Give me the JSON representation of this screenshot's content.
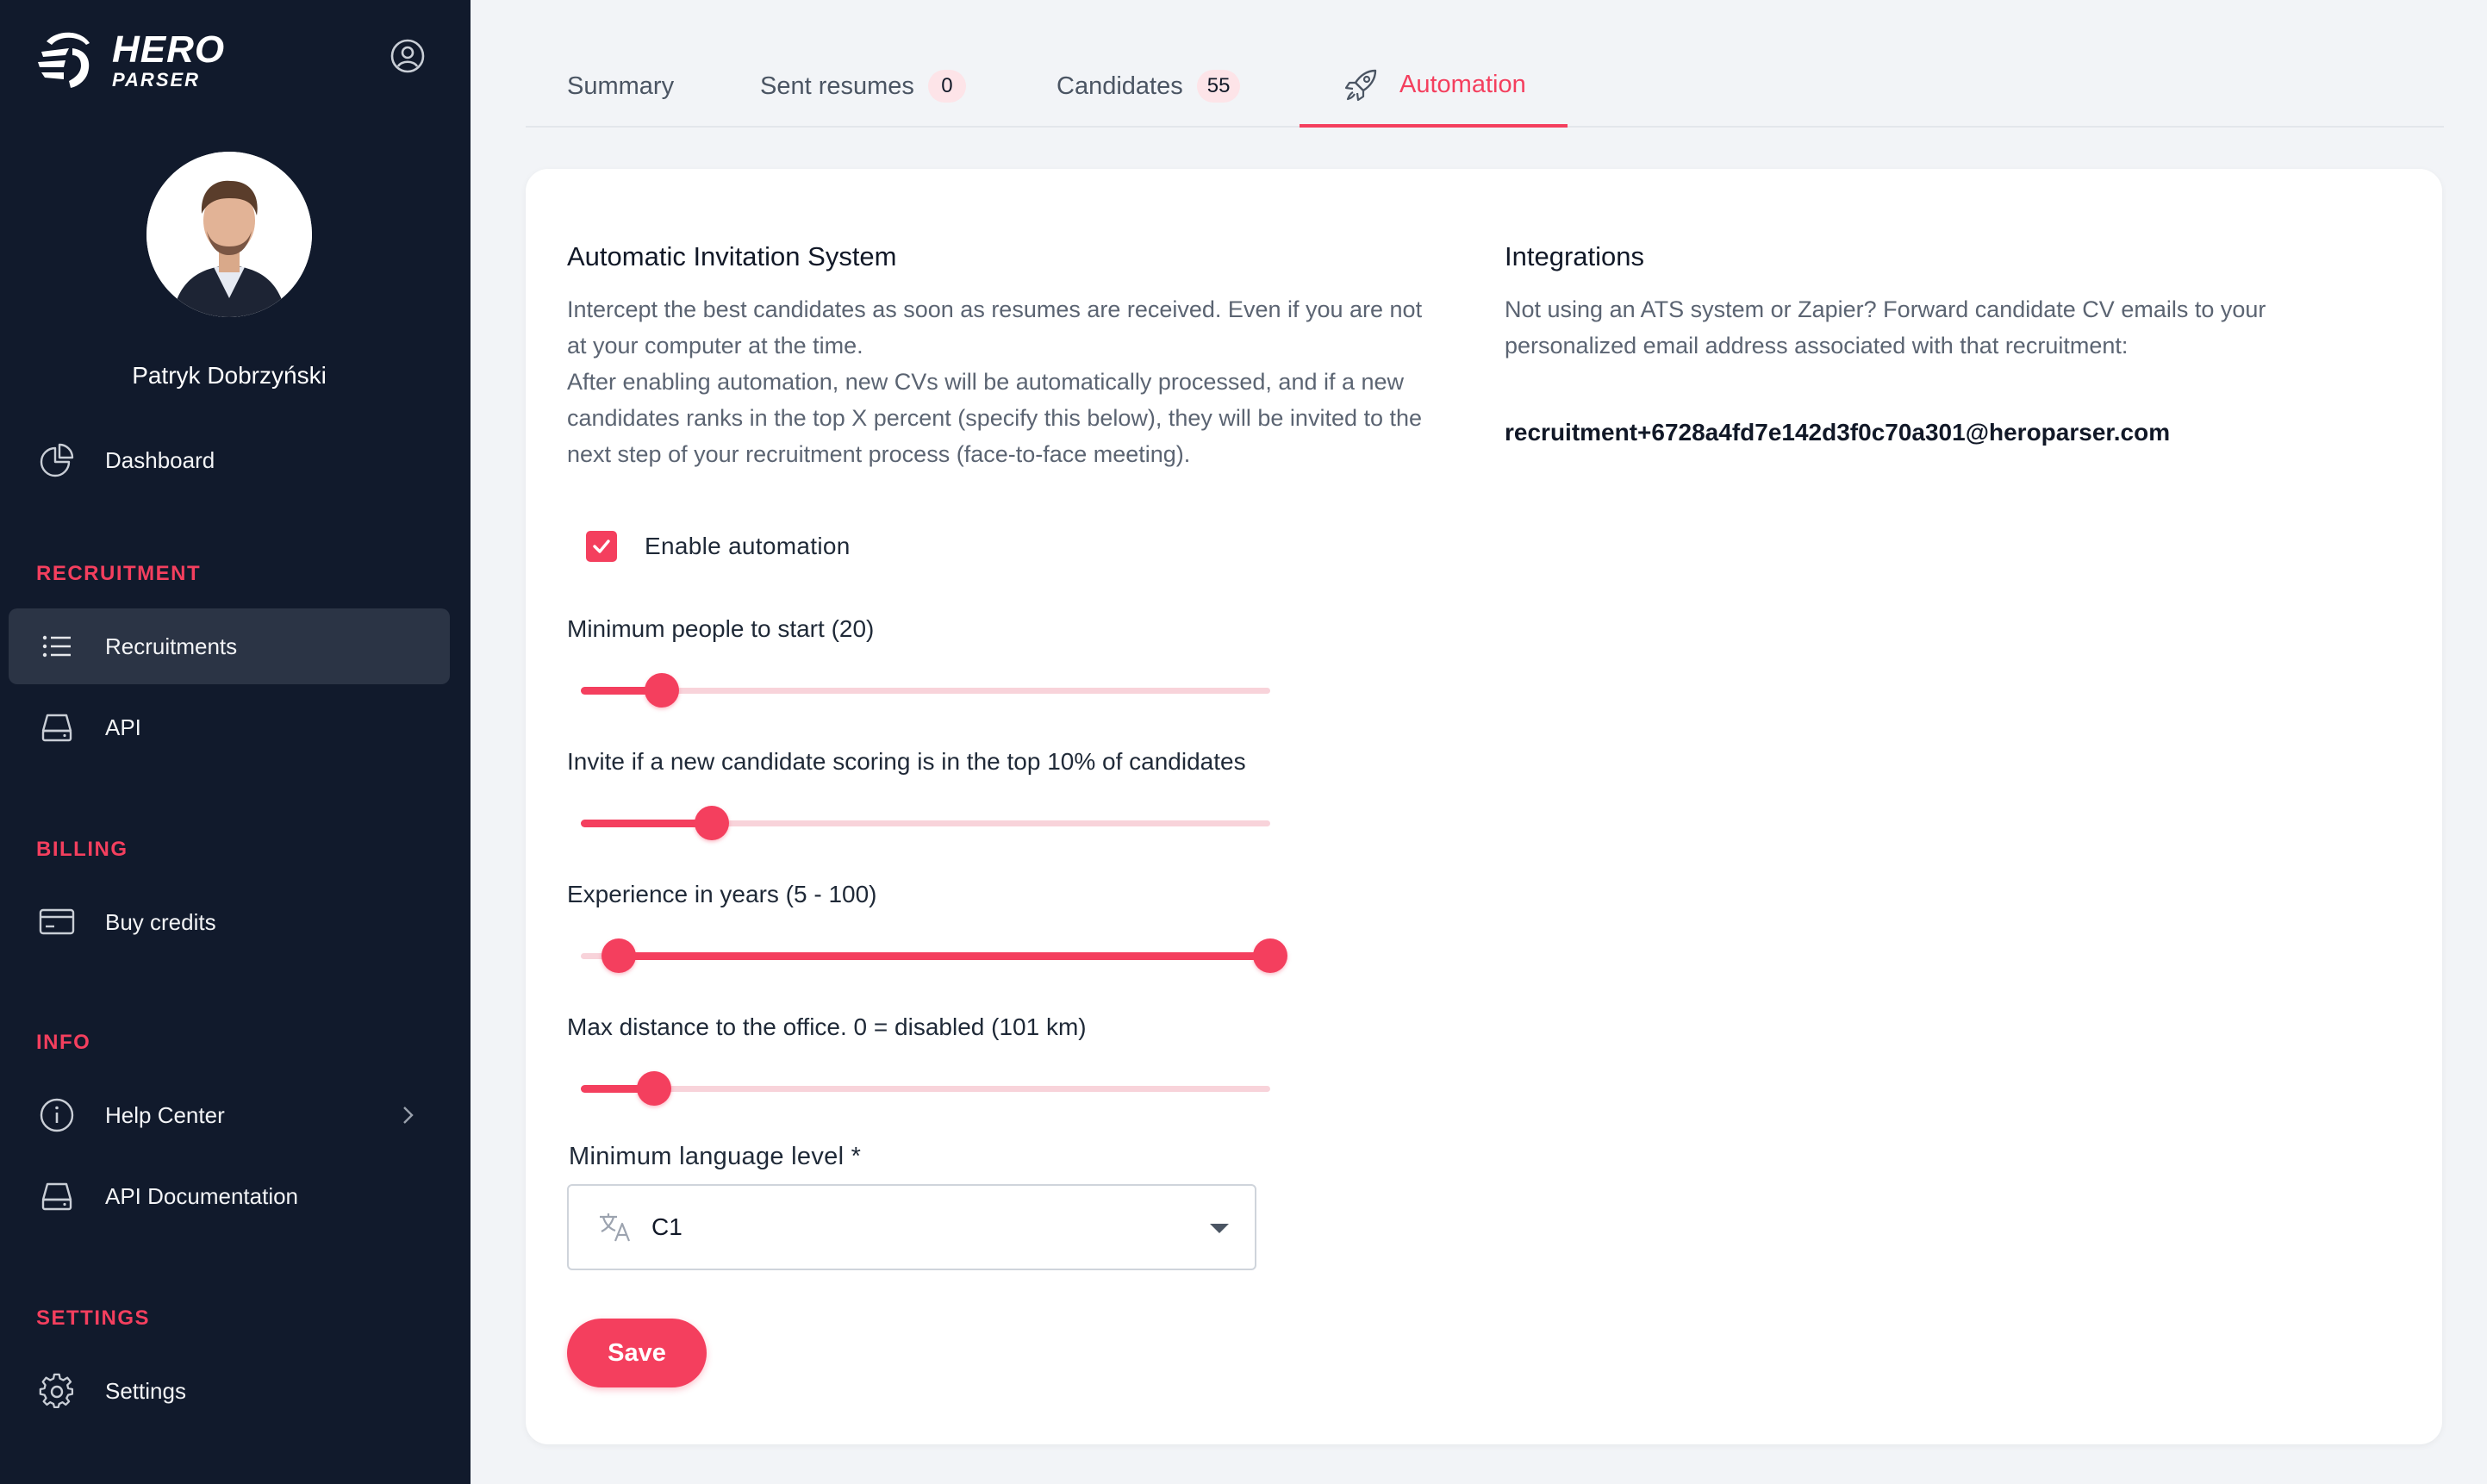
{
  "brand": {
    "line1": "HERO",
    "line2": "PARSER"
  },
  "user": {
    "name": "Patryk Dobrzyński"
  },
  "sidebar": {
    "dashboard": "Dashboard",
    "sections": {
      "recruitment": "RECRUITMENT",
      "billing": "BILLING",
      "info": "INFO",
      "settings": "SETTINGS"
    },
    "items": {
      "recruitments": "Recruitments",
      "api": "API",
      "buy_credits": "Buy credits",
      "help_center": "Help Center",
      "api_documentation": "API Documentation",
      "settings": "Settings"
    },
    "active_item": "Recruitments"
  },
  "tabs": [
    {
      "label": "Summary"
    },
    {
      "label": "Sent resumes",
      "badge": "0"
    },
    {
      "label": "Candidates",
      "badge": "55"
    },
    {
      "label": "Automation",
      "icon": "rocket-icon",
      "active": true
    }
  ],
  "automation": {
    "title": "Automatic Invitation System",
    "description": [
      "Intercept the best candidates as soon as resumes are received. Even if you are not",
      "at your computer at the time.",
      "After enabling automation, new CVs will be automatically processed, and if a new",
      "candidates ranks in the top X percent (specify this below), they will be invited to the",
      "next step of your recruitment process (face-to-face meeting)."
    ],
    "enable_label": "Enable automation",
    "enabled": true,
    "sliders": [
      {
        "label": "Minimum people to start (20)",
        "range": [
          0,
          0.118
        ]
      },
      {
        "label": "Invite if a new candidate scoring is in the top 10% of candidates",
        "range": [
          0,
          0.19
        ]
      },
      {
        "label": "Experience in years (5 - 100)",
        "range": [
          0.055,
          1.0
        ]
      },
      {
        "label": "Max distance to the office. 0 = disabled (101 km)",
        "range": [
          0,
          0.106
        ]
      }
    ],
    "language": {
      "label": "Minimum language level *",
      "value": "C1"
    },
    "save_label": "Save"
  },
  "integrations": {
    "title": "Integrations",
    "description": [
      "Not using an ATS system or Zapier? Forward candidate CV emails to your",
      "personalized email address associated with that recruitment:"
    ],
    "email": "recruitment+6728a4fd7e142d3f0c70a301@heroparser.com"
  },
  "colors": {
    "accent": "#f43f5e",
    "sidebar_bg": "#111a2c",
    "active_nav_bg": "#2b3445",
    "rail": "#f8d3da"
  }
}
